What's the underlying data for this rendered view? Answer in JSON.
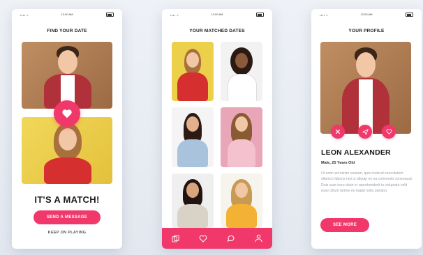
{
  "status_bar": {
    "signal": "•••• ≈",
    "time": "12:00 AM"
  },
  "screens": {
    "find": {
      "title": "FIND YOUR DATE",
      "match_heading": "IT'S A MATCH!",
      "send_button": "SEND A MESSAGE",
      "keep_link": "KEEP ON PLAYING"
    },
    "matched": {
      "title": "YOUR MATCHED DATES",
      "tabs": [
        "cards-icon",
        "heart-icon",
        "chat-icon",
        "user-icon"
      ]
    },
    "profile": {
      "title": "YOUR PROFILE",
      "name": "LEON ALEXANDER",
      "details": "Male, 25 Years Old",
      "bio": "Ut enim ad minim veniam, quis nostrud exercitation ullamco laboris nisi ut aliquip ex ea commodo consequat. Duis aute irure dolor in reprehenderit in voluptate velit esse cillum dolore eu fugiat nulla pariatur.",
      "see_more_button": "SEE MORE",
      "actions": [
        "close-icon",
        "send-icon",
        "heart-icon"
      ]
    }
  },
  "colors": {
    "accent": "#f0386b",
    "photo_brown": "#b07c55",
    "photo_yellow": "#ecd04a",
    "photo_pink": "#e9a6b8"
  }
}
